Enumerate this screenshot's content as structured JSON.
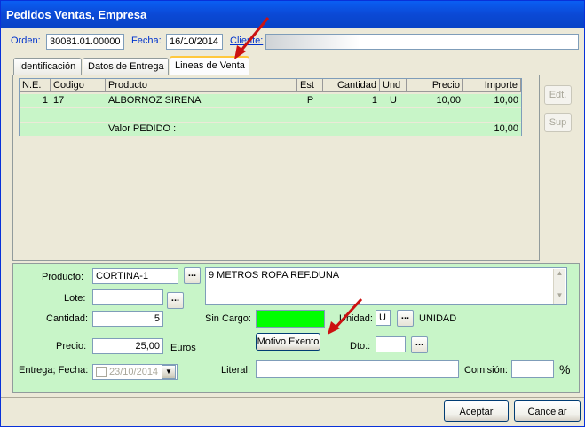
{
  "window": {
    "title": "Pedidos Ventas, Empresa"
  },
  "header": {
    "orden_label": "Orden:",
    "orden_value": "30081.01.00000",
    "fecha_label": "Fecha:",
    "fecha_value": "16/10/2014",
    "cliente_label": "Cliente:",
    "cliente_value": ""
  },
  "tabs": [
    {
      "label": "Identificación"
    },
    {
      "label": "Datos de Entrega"
    },
    {
      "label": "Lineas de Venta"
    }
  ],
  "grid": {
    "columns": [
      "N.E.",
      "Codigo",
      "Producto",
      "Est",
      "Cantidad",
      "Und",
      "Precio",
      "Importe"
    ],
    "rows": [
      {
        "ne": "1",
        "codigo": "17",
        "producto": "ALBORNOZ SIRENA",
        "est": "P",
        "cantidad": "1",
        "und": "U",
        "precio": "10,00",
        "importe": "10,00"
      }
    ],
    "total_label": "Valor PEDIDO :",
    "total_value": "10,00"
  },
  "side_buttons": {
    "edit": "Edt.",
    "delete": "Sup"
  },
  "form": {
    "producto_label": "Producto:",
    "producto_value": "CORTINA-1",
    "descripcion": "9 METROS ROPA REF.DUNA",
    "lote_label": "Lote:",
    "lote_value": "",
    "cantidad_label": "Cantidad:",
    "cantidad_value": "5",
    "sin_cargo_label": "Sin Cargo:",
    "unidad_label": "Unidad:",
    "unidad_value": "U",
    "unidad_desc": "UNIDAD",
    "precio_label": "Precio:",
    "precio_value": "25,00",
    "euros_label": "Euros",
    "motivo_button": "Motivo Exento",
    "dto_label": "Dto.:",
    "dto_value": "",
    "entrega_label": "Entrega; Fecha:",
    "entrega_date": "23/10/2014",
    "literal_label": "Literal:",
    "literal_value": "",
    "comision_label": "Comisión:",
    "comision_value": "",
    "percent": "%",
    "ellipsis": "..."
  },
  "footer": {
    "accept": "Aceptar",
    "cancel": "Cancelar"
  },
  "colors": {
    "title_bar": "#0a5ff3",
    "row_highlight": "#c8f5c8",
    "sin_cargo": "#00ff00",
    "arrow": "#cc1111"
  }
}
